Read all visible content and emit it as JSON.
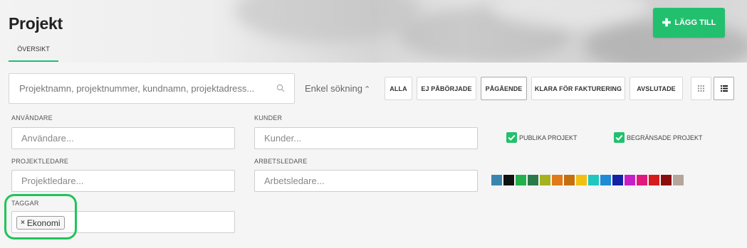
{
  "header": {
    "title": "Projekt",
    "tabs": [
      {
        "label": "ÖVERSIKT",
        "active": true
      }
    ],
    "add_button": {
      "label": "LÄGG TILL",
      "icon": "plus-icon",
      "color": "#22c06e"
    }
  },
  "search": {
    "placeholder": "Projektnamn, projektnummer, kundnamn, projektadress...",
    "value": "",
    "toggle_label": "Enkel sökning",
    "toggle_icon": "chevron-up-icon"
  },
  "status_filters": [
    {
      "label": "ALLA",
      "active": false
    },
    {
      "label": "EJ PÅBÖRJADE",
      "active": false
    },
    {
      "label": "PÅGÅENDE",
      "active": true
    },
    {
      "label": "KLARA FÖR FAKTURERING",
      "active": false
    },
    {
      "label": "AVSLUTADE",
      "active": false
    }
  ],
  "view_toggles": [
    {
      "name": "grid-view",
      "icon": "grid-icon",
      "active": false
    },
    {
      "name": "list-view",
      "icon": "list-icon",
      "active": true
    }
  ],
  "fields": {
    "users": {
      "label": "ANVÄNDARE",
      "placeholder": "Användare..."
    },
    "customers": {
      "label": "KUNDER",
      "placeholder": "Kunder..."
    },
    "project_leaders": {
      "label": "PROJEKTLEDARE",
      "placeholder": "Projektledare..."
    },
    "work_leaders": {
      "label": "ARBETSLEDARE",
      "placeholder": "Arbetsledare..."
    },
    "tags": {
      "label": "TAGGAR",
      "values": [
        "Ekonomi"
      ]
    }
  },
  "checkboxes": [
    {
      "label": "PUBLIKA PROJEKT",
      "checked": true
    },
    {
      "label": "BEGRÄNSADE PROJEKT",
      "checked": true
    }
  ],
  "colors": {
    "accent": "#22c06e",
    "highlight": "#22c35a",
    "swatches": [
      "#3a85b0",
      "#111111",
      "#22b14c",
      "#2a7a4a",
      "#a6b21e",
      "#e07a1a",
      "#c4700e",
      "#f2c011",
      "#1ec8c0",
      "#1f8ad6",
      "#1622a6",
      "#c81ec8",
      "#e0197a",
      "#d41c1c",
      "#8a0c0c",
      "#b5a59a"
    ]
  }
}
